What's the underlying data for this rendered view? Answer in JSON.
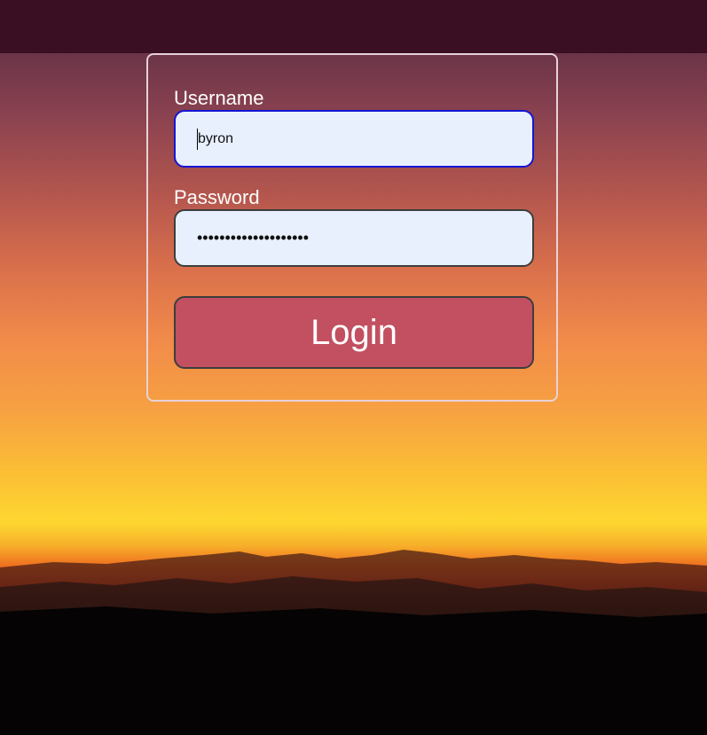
{
  "login_form": {
    "username_label": "Username",
    "username_value": "byron",
    "password_label": "Password",
    "password_masked": "••••••••••••••••••••",
    "login_button_label": "Login"
  },
  "colors": {
    "topbar": "#3a0f24",
    "input_background": "#e8f0fe",
    "focused_border": "#1515d6",
    "button": "#c25060"
  }
}
